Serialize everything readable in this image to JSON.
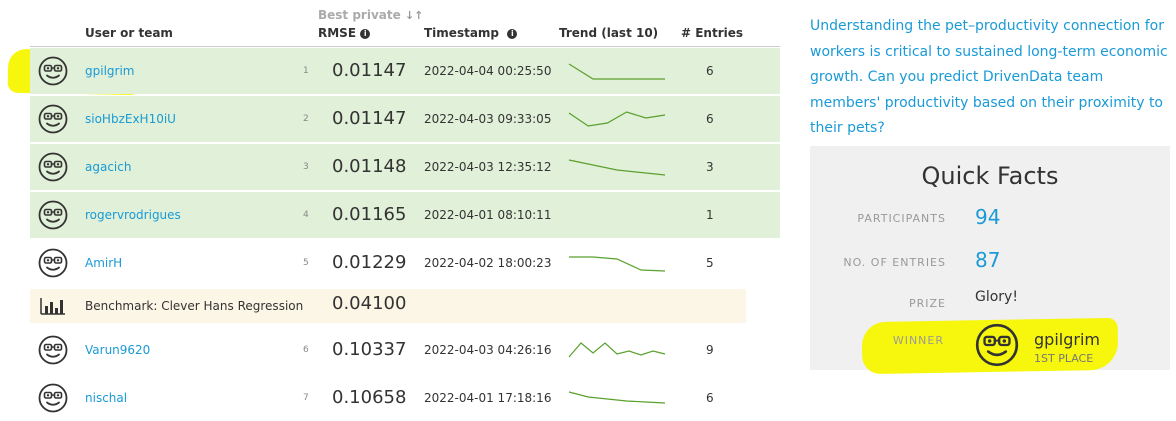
{
  "table": {
    "headers": {
      "user": "User or team",
      "best_private": "Best private",
      "metric": "RMSE",
      "timestamp": "Timestamp",
      "trend": "Trend (last 10)",
      "entries": "# Entries"
    },
    "rows": [
      {
        "name": "gpilgrim",
        "rank": "1",
        "score": "0.01147",
        "timestamp": "2022-04-04 00:25:50",
        "entries": "6",
        "trend": [
          0.9,
          0.15,
          0.15,
          0.15,
          0.15
        ]
      },
      {
        "name": "sioHbzExH10iU",
        "rank": "2",
        "score": "0.01147",
        "timestamp": "2022-04-03 09:33:05",
        "entries": "6",
        "trend": [
          0.85,
          0.2,
          0.35,
          0.9,
          0.6,
          0.75
        ]
      },
      {
        "name": "agacich",
        "rank": "3",
        "score": "0.01148",
        "timestamp": "2022-04-03 12:35:12",
        "entries": "3",
        "trend": [
          0.9,
          0.4,
          0.15
        ]
      },
      {
        "name": "rogervrodrigues",
        "rank": "4",
        "score": "0.01165",
        "timestamp": "2022-04-01 08:10:11",
        "entries": "1",
        "trend": []
      },
      {
        "name": "AmirH",
        "rank": "5",
        "score": "0.01229",
        "timestamp": "2022-04-02 18:00:23",
        "entries": "5",
        "trend": [
          0.85,
          0.85,
          0.75,
          0.2,
          0.15
        ]
      },
      {
        "name": "Varun9620",
        "rank": "6",
        "score": "0.10337",
        "timestamp": "2022-04-03 04:26:16",
        "entries": "9",
        "trend": [
          0.2,
          0.9,
          0.4,
          0.9,
          0.35,
          0.5,
          0.3,
          0.5,
          0.35
        ]
      },
      {
        "name": "nischal",
        "rank": "7",
        "score": "0.10658",
        "timestamp": "2022-04-01 17:18:16",
        "entries": "6",
        "trend": [
          0.85,
          0.6,
          0.5,
          0.4,
          0.35,
          0.3
        ]
      }
    ],
    "benchmark": {
      "name": "Benchmark: Clever Hans Regression",
      "score": "0.04100"
    }
  },
  "description": "Understanding the pet–productivity connection for workers is critical to sustained long-term economic growth. Can you predict DrivenData team members' productivity based on their proximity to their pets?",
  "quick_facts": {
    "title": "Quick Facts",
    "participants_label": "PARTICIPANTS",
    "participants": "94",
    "entries_label": "NO. OF ENTRIES",
    "entries": "87",
    "prize_label": "PRIZE",
    "prize": "Glory!",
    "winner_label": "WINNER",
    "winner_name": "gpilgrim",
    "winner_place": "1ST PLACE"
  },
  "colors": {
    "accent": "#1a9ad6",
    "green_row": "#e1f0d8",
    "highlight": "#f7f700",
    "trend_line": "#5aa02c"
  },
  "icons": {
    "avatar": "smiley-glasses-icon",
    "benchmark": "bar-chart-icon",
    "sort": "sort-icon",
    "info": "info-icon"
  }
}
